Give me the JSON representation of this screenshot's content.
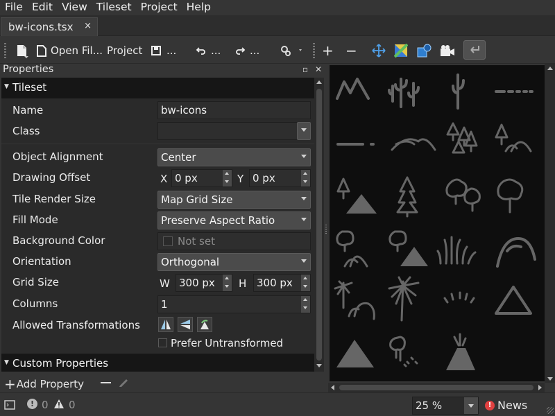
{
  "menu": {
    "items": [
      "File",
      "Edit",
      "View",
      "Tileset",
      "Project",
      "Help"
    ]
  },
  "tab": {
    "title": "bw-icons.tsx",
    "close": "×"
  },
  "toolbar": {
    "open_file_label": "Open Fil...",
    "project_label": "Project",
    "save_more": "...",
    "undo_more": "...",
    "redo_more": "...",
    "add": "+",
    "remove": "−"
  },
  "properties": {
    "title": "Properties",
    "group_tileset": "Tileset",
    "group_custom": "Custom Properties",
    "rows": {
      "name": {
        "label": "Name",
        "value": "bw-icons"
      },
      "class": {
        "label": "Class",
        "value": ""
      },
      "object_alignment": {
        "label": "Object Alignment",
        "value": "Center"
      },
      "drawing_offset": {
        "label": "Drawing Offset",
        "x_label": "X",
        "x_value": "0 px",
        "y_label": "Y",
        "y_value": "0 px"
      },
      "tile_render_size": {
        "label": "Tile Render Size",
        "value": "Map Grid Size"
      },
      "fill_mode": {
        "label": "Fill Mode",
        "value": "Preserve Aspect Ratio"
      },
      "background_color": {
        "label": "Background Color",
        "value": "Not set"
      },
      "orientation": {
        "label": "Orientation",
        "value": "Orthogonal"
      },
      "grid_size": {
        "label": "Grid Size",
        "w_label": "W",
        "w_value": "300 px",
        "h_label": "H",
        "h_value": "300 px"
      },
      "columns": {
        "label": "Columns",
        "value": "1"
      },
      "allowed_transformations": {
        "label": "Allowed Transformations",
        "prefer_untransformed": "Prefer Untransformed"
      }
    },
    "add_property": "Add Property"
  },
  "tiles": [
    "mountains-icon",
    "cactus-group-icon",
    "cactus-icon",
    "dashes-icon",
    "dash-line-icon",
    "hills-outline-icon",
    "pine-forest-icon",
    "tree-hills-icon",
    "pine-mountain-icon",
    "pine-tree-icon",
    "deciduous-forest-icon",
    "deciduous-tree-icon",
    "tree-hills-2-icon",
    "tree-mountain-icon",
    "grass-icon",
    "hills-icon",
    "palm-hills-icon",
    "palm-tree-icon",
    "sprout-icon",
    "triangle-outline-icon",
    "triangle-filled-icon",
    "tree-dots-icon",
    "volcano-icon"
  ],
  "status": {
    "errors": "0",
    "warnings": "0",
    "zoom": "25 %",
    "news": "News"
  },
  "colors": {
    "tile_icon": "#666666",
    "tile_bg": "#0e0e0e",
    "news_accent": "#e04040"
  }
}
